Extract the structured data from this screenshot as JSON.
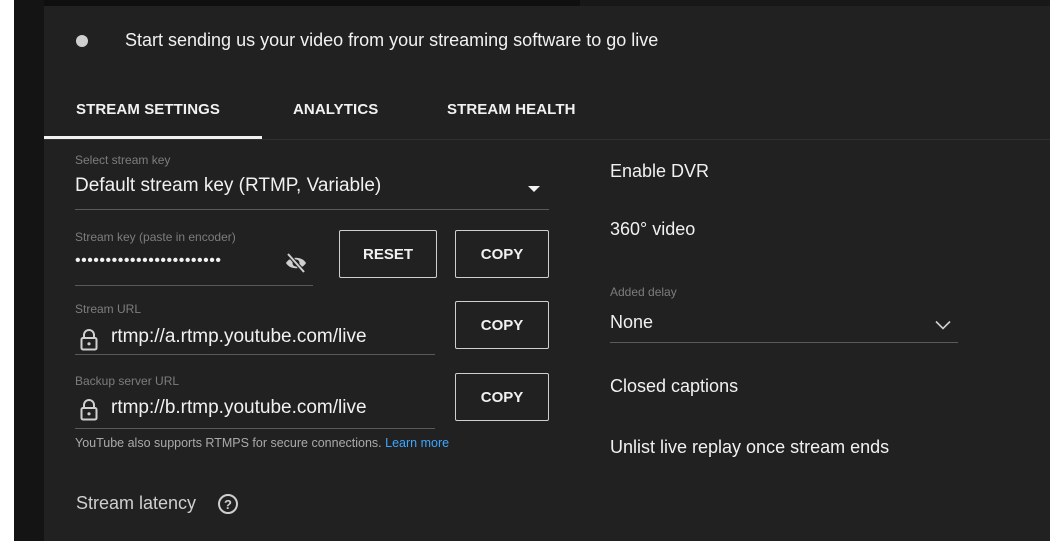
{
  "banner": {
    "status_text": "Start sending us your video from your streaming software to go live"
  },
  "tabs": [
    {
      "label": "STREAM SETTINGS",
      "active": true
    },
    {
      "label": "ANALYTICS",
      "active": false
    },
    {
      "label": "STREAM HEALTH",
      "active": false
    }
  ],
  "stream_key_select": {
    "label": "Select stream key",
    "value": "Default stream key (RTMP, Variable)"
  },
  "stream_key": {
    "label": "Stream key (paste in encoder)",
    "value": "••••••••••••••••••••••••",
    "reset_label": "RESET",
    "copy_label": "COPY"
  },
  "stream_url": {
    "label": "Stream URL",
    "value": "rtmp://a.rtmp.youtube.com/live",
    "copy_label": "COPY"
  },
  "backup_url": {
    "label": "Backup server URL",
    "value": "rtmp://b.rtmp.youtube.com/live",
    "copy_label": "COPY"
  },
  "rtmps_note": {
    "text": "YouTube also supports RTMPS for secure connections.",
    "link": "Learn more"
  },
  "stream_latency": {
    "label": "Stream latency",
    "help": "?"
  },
  "right": {
    "enable_dvr": "Enable DVR",
    "video_360": "360° video",
    "added_delay_label": "Added delay",
    "added_delay_value": "None",
    "closed_captions": "Closed captions",
    "unlist_replay": "Unlist live replay once stream ends"
  },
  "colors": {
    "background": "#212121",
    "accent_link": "#3ea6ff",
    "status_dot": "#cfcfcf"
  },
  "icons": [
    "status-dot",
    "caret-down-icon",
    "visibility-off-icon",
    "lock-icon",
    "chevron-down-icon",
    "help-icon"
  ]
}
